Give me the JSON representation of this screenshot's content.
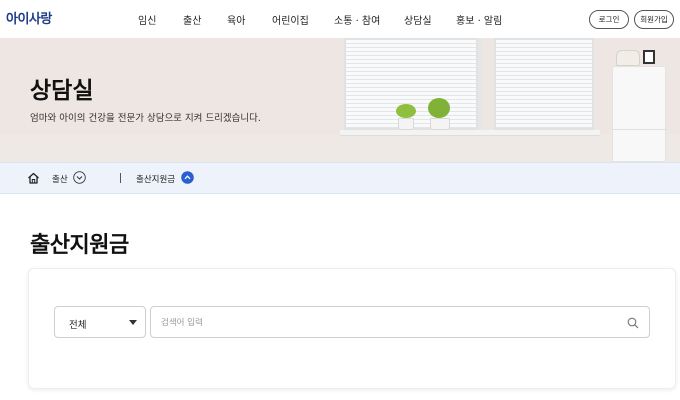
{
  "header": {
    "logo": "아이사랑",
    "nav": [
      "임신",
      "출산",
      "육아",
      "어린이집",
      "소통 · 참여",
      "상담실",
      "홍보 · 알림"
    ],
    "login_label": "로그인",
    "signup_label": "회원가입"
  },
  "hero": {
    "title": "상담실",
    "subtitle": "엄마와 아이의 건강을 전문가 상담으로 지켜 드리겠습니다."
  },
  "breadcrumb": {
    "level1": "출산",
    "level2": "출산지원금"
  },
  "page": {
    "title": "출산지원금"
  },
  "search": {
    "category_selected": "전체",
    "placeholder": "검색어 입력",
    "value": ""
  },
  "colors": {
    "brand": "#1f3c88",
    "accent_icon": "#2b5fd1",
    "crumb_bg": "#edf2fb"
  }
}
